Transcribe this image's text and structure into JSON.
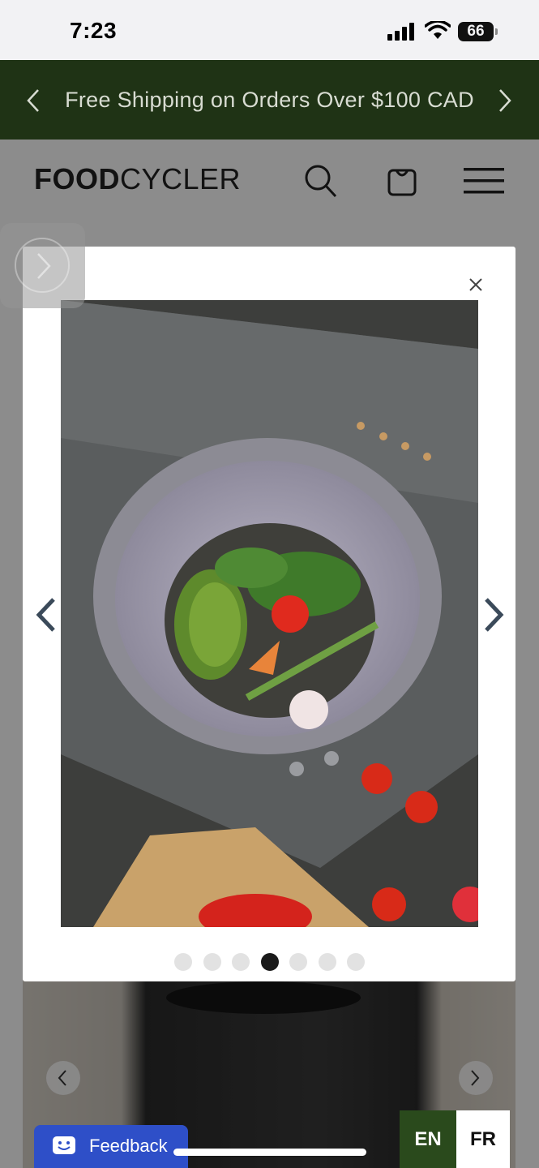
{
  "status_bar": {
    "time": "7:23",
    "battery": "66"
  },
  "announcement": {
    "text": "Free Shipping on Orders Over $100 CAD",
    "prev_icon": "chevron-left-icon",
    "next_icon": "chevron-right-icon"
  },
  "header": {
    "logo_bold": "FOOD",
    "logo_light": "CYCLER",
    "icons": [
      "search-icon",
      "cart-icon",
      "menu-icon"
    ]
  },
  "gallery": {
    "total_slides": 7,
    "active_slide": 4,
    "image_description_icon": "product-photo"
  },
  "feedback": {
    "label": "Feedback"
  },
  "language": {
    "en": "EN",
    "fr": "FR",
    "active": "EN"
  },
  "colors": {
    "announce_bg": "#1f3315",
    "lang_active_bg": "#2a4a1c",
    "feedback_bg": "#2e4fc8"
  }
}
